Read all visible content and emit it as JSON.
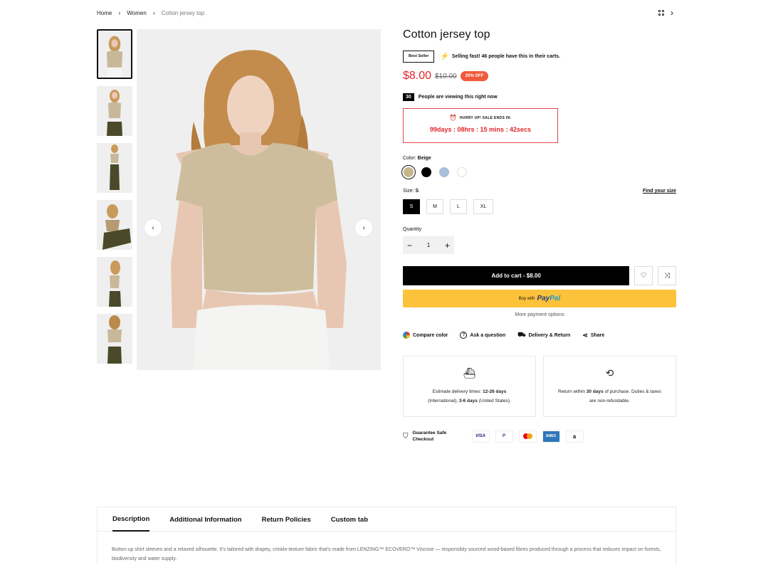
{
  "breadcrumb": {
    "home": "Home",
    "category": "Women",
    "current": "Cotton jersey top"
  },
  "product": {
    "title": "Cotton jersey top",
    "badge": "Best Seller",
    "selling_fast": "Selling fast! 46 people have this in their carts.",
    "price": "$8.00",
    "old_price": "$10.00",
    "discount": "20% OFF",
    "viewers_count": "30",
    "viewers_text": "People are viewing this right now",
    "timer_heading": "HURRY UP! SALE ENDS IN:",
    "timer_value": "99days : 08hrs : 15 mins : 42secs",
    "color_label": "Color:",
    "color_value": "Beige",
    "colors": [
      "#c8b58a",
      "#000000",
      "#a8bfd9",
      "#ffffff"
    ],
    "size_label": "Size:",
    "size_value": "S",
    "find_size": "Find your size",
    "sizes": [
      "S",
      "M",
      "L",
      "XL"
    ],
    "quantity_label": "Quantity",
    "quantity": "1",
    "add_to_cart": "Add to cart - $8.00",
    "buy_with": "Buy with",
    "paypal_1": "Pay",
    "paypal_2": "Pal",
    "more_payment": "More payment options"
  },
  "actions": {
    "compare": "Compare color",
    "ask": "Ask a question",
    "delivery": "Delivery & Return",
    "share": "Share"
  },
  "info_boxes": {
    "delivery_pre": "Estimate delivery times: ",
    "delivery_intl": "12-26 days",
    "delivery_mid": " (International), ",
    "delivery_us": "3-6 days",
    "delivery_post": " (United States).",
    "return_pre": "Return within ",
    "return_days": "30 days",
    "return_post": " of purchase. Duties & taxes are non-refundable."
  },
  "guarantee": "Guarantee Safe Checkout",
  "payment_cards": [
    "VISA",
    "P",
    "",
    "AMEX",
    "a"
  ],
  "tabs": [
    "Description",
    "Additional Information",
    "Return Policies",
    "Custom tab"
  ],
  "description": "Button-up shirt sleeves and a relaxed silhouette. It's tailored with drapey, crinkle-texture fabric that's made from LENZING™ ECOVERO™ Viscose — responsibly sourced wood-based fibres produced through a process that reduces impact on forests, biodiversity and water supply."
}
